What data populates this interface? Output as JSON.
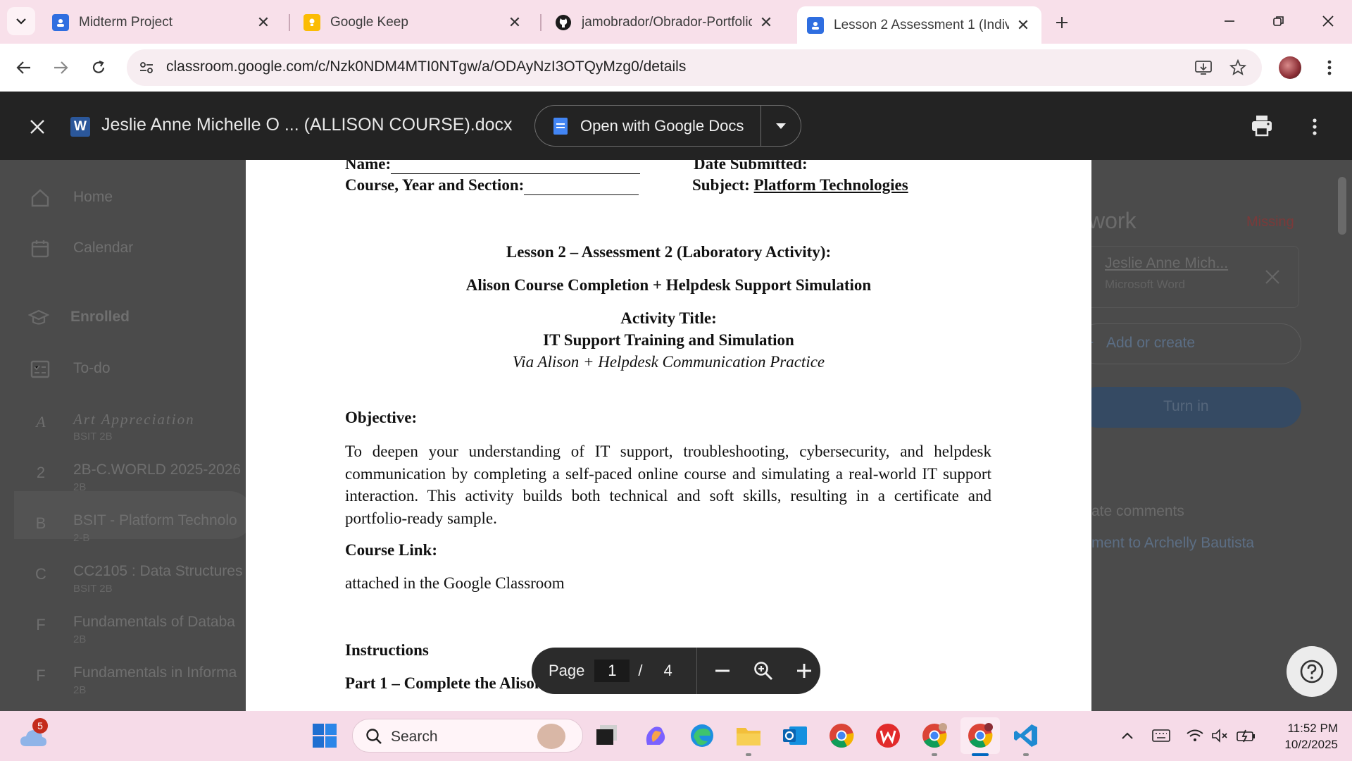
{
  "browser": {
    "tabs": [
      {
        "title": "Midterm Project",
        "active": false
      },
      {
        "title": "Google Keep",
        "active": false
      },
      {
        "title": "jamobrador/Obrador-Portfolio",
        "active": false
      },
      {
        "title": "Lesson 2 Assessment 1 (Individu",
        "active": true
      }
    ],
    "url": "classroom.google.com/c/Nzk0NDM4MTI0NTgw/a/ODAyNzI3OTQyMzg0/details"
  },
  "viewer": {
    "file_name": "Jeslie Anne Michelle O ... (ALLISON COURSE).docx",
    "open_with_label": "Open with Google Docs",
    "word_badge": "W"
  },
  "sidebar": {
    "items": [
      {
        "label": "Home",
        "icon": "home-icon"
      },
      {
        "label": "Calendar",
        "icon": "calendar-icon"
      },
      {
        "label": "Enrolled",
        "icon": "graduation-cap-icon"
      },
      {
        "label": "To-do",
        "icon": "todo-icon"
      }
    ],
    "classes": [
      {
        "letter": "A",
        "name": "Art Appreciation",
        "section": "BSIT 2B"
      },
      {
        "letter": "2",
        "name": "2B-C.WORLD 2025-2026",
        "section": "2B"
      },
      {
        "letter": "B",
        "name": "BSIT - Platform Technolo",
        "section": "2-B"
      },
      {
        "letter": "C",
        "name": "CC2105 : Data Structures",
        "section": "BSIT 2B"
      },
      {
        "letter": "F",
        "name": "Fundamentals of Databa",
        "section": "2B"
      },
      {
        "letter": "F",
        "name": "Fundamentals in Informa",
        "section": "2B"
      }
    ]
  },
  "right_panel": {
    "work_title": "work",
    "status": "Missing",
    "attachment_name": "Jeslie Anne Mich...",
    "attachment_type": "Microsoft Word",
    "add_or_create": "Add or create",
    "turn_in": "Turn in",
    "private_comments": "ate comments",
    "add_comment": "ment to Archelly Bautista"
  },
  "document": {
    "name_label": "Name:",
    "date_label": "Date Submitted:",
    "course_label": "Course, Year and Section:",
    "subject_label": "Subject:",
    "subject_value": "Platform Technologies",
    "lesson_heading": "Lesson 2 – Assessment 2 (Laboratory Activity):",
    "subtitle": "Alison Course Completion + Helpdesk Support Simulation",
    "activity_title_label": "Activity Title:",
    "activity_title": "IT Support Training and Simulation",
    "activity_via": "Via Alison + Helpdesk Communication Practice",
    "objective_heading": "Objective:",
    "objective_text": "To deepen your understanding of IT support, troubleshooting, cybersecurity, and helpdesk communication by completing a self-paced online course and simulating a real-world IT support interaction. This activity builds both technical and soft skills, resulting in a certificate and portfolio-ready sample.",
    "course_link_heading": "Course Link:",
    "course_link_text": "attached in the Google Classroom",
    "instructions_heading": "Instructions",
    "part1_heading": "Part 1 – Complete the Alison Course:"
  },
  "pager": {
    "label": "Page",
    "current": "1",
    "separator": "/",
    "total": "4"
  },
  "taskbar": {
    "notification_count": "5",
    "search_label": "Search",
    "time": "11:52 PM",
    "date": "10/2/2025"
  }
}
